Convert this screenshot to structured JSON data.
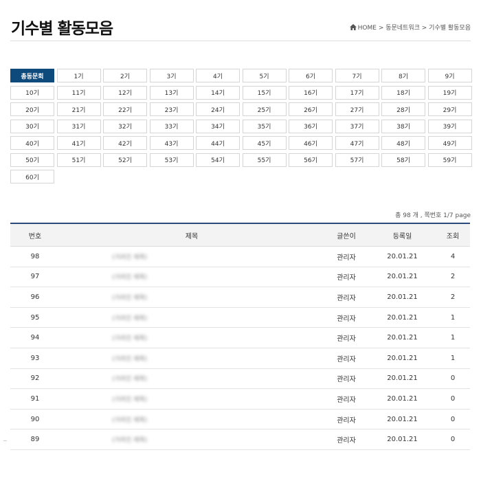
{
  "header": {
    "title": "기수별 활동모음",
    "breadcrumb": [
      "HOME",
      "동문네트워크",
      "기수별 활동모음"
    ],
    "breadcrumb_separator": " > ",
    "home_icon": "home-icon"
  },
  "generations": [
    "총동문회",
    "1기",
    "2기",
    "3기",
    "4기",
    "5기",
    "6기",
    "7기",
    "8기",
    "9기",
    "10기",
    "11기",
    "12기",
    "13기",
    "14기",
    "15기",
    "16기",
    "17기",
    "18기",
    "19기",
    "20기",
    "21기",
    "22기",
    "23기",
    "24기",
    "25기",
    "26기",
    "27기",
    "28기",
    "29기",
    "30기",
    "31기",
    "32기",
    "33기",
    "34기",
    "35기",
    "36기",
    "37기",
    "38기",
    "39기",
    "40기",
    "41기",
    "42기",
    "43기",
    "44기",
    "45기",
    "46기",
    "47기",
    "48기",
    "49기",
    "50기",
    "51기",
    "52기",
    "53기",
    "54기",
    "55기",
    "56기",
    "57기",
    "58기",
    "59기",
    "60기"
  ],
  "active_generation": "총동문회",
  "list_info": "총 98 개 , 쪽번호 1/7 page",
  "table": {
    "columns": [
      "번호",
      "제목",
      "글쓴이",
      "등록일",
      "조회"
    ],
    "rows": [
      {
        "no": "98",
        "title": "(가려진 제목)",
        "author": "관리자",
        "date": "20.01.21",
        "views": "4"
      },
      {
        "no": "97",
        "title": "(가려진 제목)",
        "author": "관리자",
        "date": "20.01.21",
        "views": "2"
      },
      {
        "no": "96",
        "title": "(가려진 제목)",
        "author": "관리자",
        "date": "20.01.21",
        "views": "2"
      },
      {
        "no": "95",
        "title": "(가려진 제목)",
        "author": "관리자",
        "date": "20.01.21",
        "views": "1"
      },
      {
        "no": "94",
        "title": "(가려진 제목)",
        "author": "관리자",
        "date": "20.01.21",
        "views": "1"
      },
      {
        "no": "93",
        "title": "(가려진 제목)",
        "author": "관리자",
        "date": "20.01.21",
        "views": "1"
      },
      {
        "no": "92",
        "title": "(가려진 제목)",
        "author": "관리자",
        "date": "20.01.21",
        "views": "0"
      },
      {
        "no": "91",
        "title": "(가려진 제목)",
        "author": "관리자",
        "date": "20.01.21",
        "views": "0"
      },
      {
        "no": "90",
        "title": "(가려진 제목)",
        "author": "관리자",
        "date": "20.01.21",
        "views": "0"
      },
      {
        "no": "89",
        "title": "(가려진 제목)",
        "author": "관리자",
        "date": "20.01.21",
        "views": "0"
      }
    ]
  },
  "colors": {
    "accent": "#0f4a7c",
    "table_top_border": "#2b4a7c",
    "header_bg": "#f3f3f3"
  }
}
